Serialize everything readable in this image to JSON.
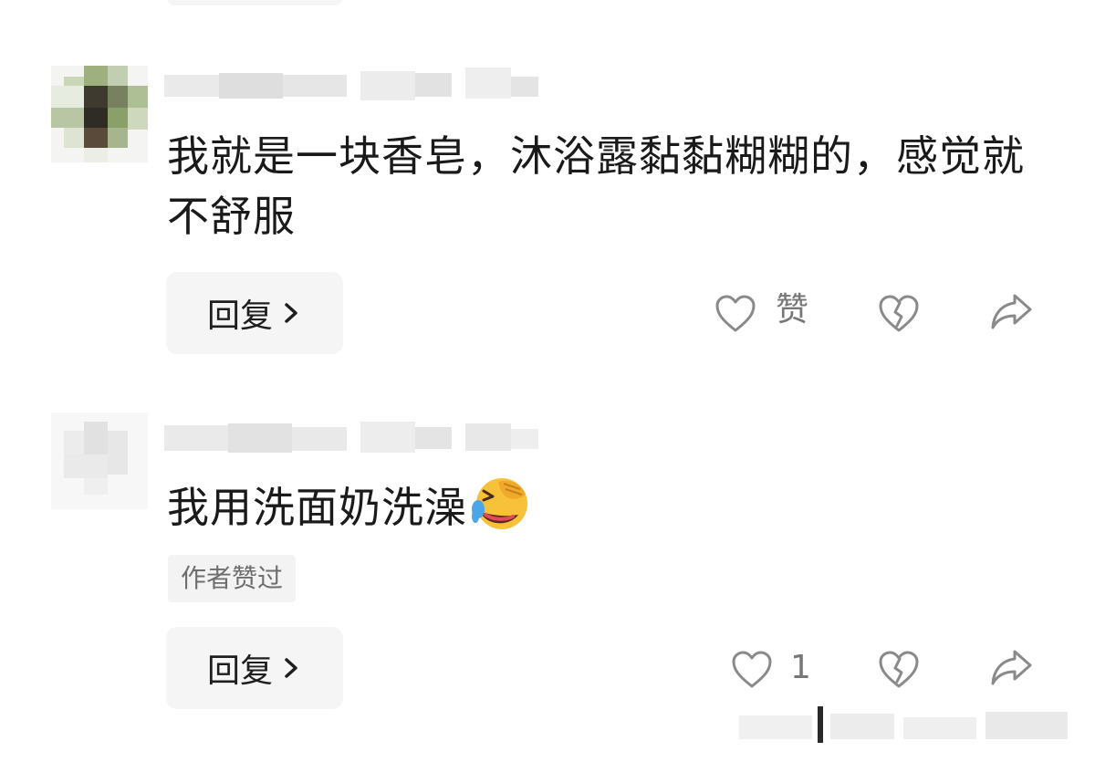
{
  "comments": [
    {
      "text": "我就是一块香皂，沐浴露黏黏糊糊的，感觉就不舒服",
      "author_badge": "",
      "reply_label": "回复",
      "like_label": "赞",
      "icons": {
        "like": "heart-outline-icon",
        "dislike": "broken-heart-icon",
        "share": "share-arrow-icon",
        "reply_chevron": "chevron-right-icon"
      }
    },
    {
      "text": "我用洗面奶洗澡",
      "emoji": "laughing-crying-emoji",
      "author_badge": "作者赞过",
      "reply_label": "回复",
      "like_label": "1",
      "icons": {
        "like": "heart-outline-icon",
        "dislike": "broken-heart-icon",
        "share": "share-arrow-icon",
        "reply_chevron": "chevron-right-icon"
      }
    }
  ],
  "colors": {
    "text": "#1a1a1a",
    "muted": "#777777",
    "button_bg": "#f5f5f5",
    "badge_bg": "#f3f3f3",
    "icon_stroke": "#8a8a8a"
  }
}
